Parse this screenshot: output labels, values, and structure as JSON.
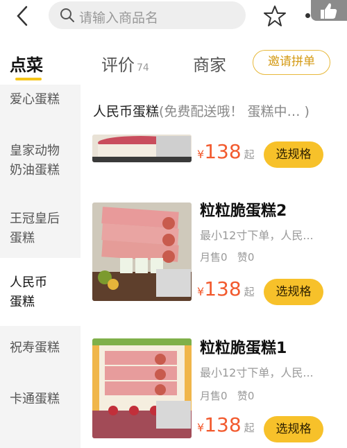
{
  "search": {
    "placeholder": "请输入商品名"
  },
  "tabs": [
    {
      "label": "点菜"
    },
    {
      "label": "评价",
      "count": "74"
    },
    {
      "label": "商家"
    }
  ],
  "invite_label": "邀请拼单",
  "sidebar": {
    "items": [
      {
        "label": "爱心蛋糕"
      },
      {
        "label_line1": "皇家动物",
        "label_line2": "奶油蛋糕"
      },
      {
        "label_line1": "王冠皇后",
        "label_line2": "蛋糕"
      },
      {
        "label_line1": "人民币",
        "label_line2": "蛋糕"
      },
      {
        "label": "祝寿蛋糕"
      },
      {
        "label": "卡通蛋糕"
      }
    ]
  },
  "section": {
    "title": "人民币蛋糕",
    "note": "(免费配送哦！ 蛋糕中… )"
  },
  "products": [
    {
      "price_symbol": "¥",
      "price": "138",
      "from": "起",
      "button": "选规格"
    },
    {
      "name": "粒粒脆蛋糕2",
      "desc": "最小12寸下单，人民...",
      "sales": "月售0",
      "likes": "赞0",
      "price_symbol": "¥",
      "price": "138",
      "from": "起",
      "button": "选规格"
    },
    {
      "name": "粒粒脆蛋糕1",
      "desc": "最小12寸下单，人民...",
      "sales": "月售0",
      "likes": "赞0",
      "price_symbol": "¥",
      "price": "138",
      "from": "起",
      "button": "选规格"
    }
  ],
  "colors": {
    "accent": "#f7c12a",
    "price": "#f25a2e",
    "sidebar_bg": "#f4f4f4"
  }
}
